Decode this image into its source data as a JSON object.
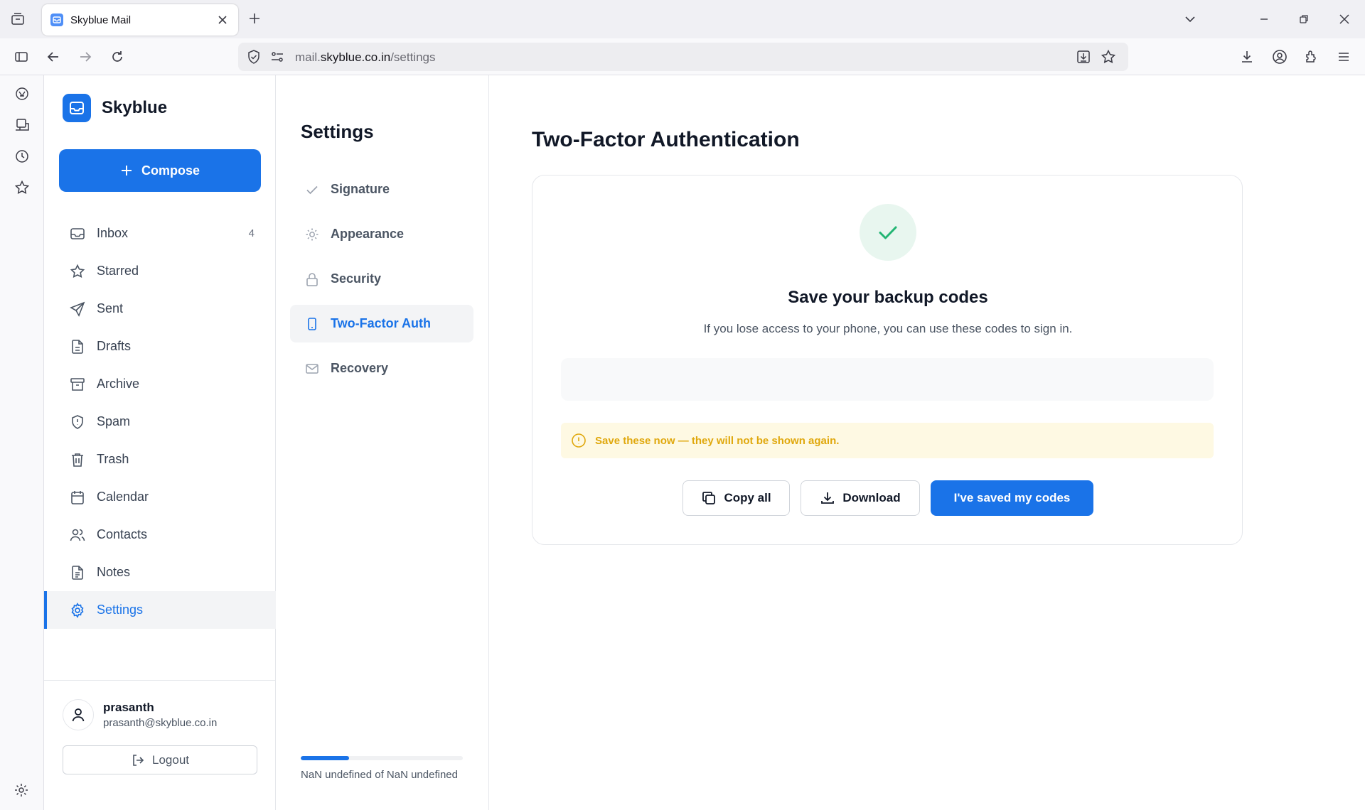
{
  "browser": {
    "tab_title": "Skyblue Mail",
    "url_host": "mail.skyblue.co.in",
    "url_path": "/settings"
  },
  "app": {
    "brand": "Skyblue",
    "compose_label": "Compose",
    "nav": [
      {
        "label": "Inbox",
        "icon": "inbox-icon",
        "count": "4"
      },
      {
        "label": "Starred",
        "icon": "star-icon"
      },
      {
        "label": "Sent",
        "icon": "send-icon"
      },
      {
        "label": "Drafts",
        "icon": "file-icon"
      },
      {
        "label": "Archive",
        "icon": "archive-icon"
      },
      {
        "label": "Spam",
        "icon": "shield-icon"
      },
      {
        "label": "Trash",
        "icon": "trash-icon"
      },
      {
        "label": "Calendar",
        "icon": "calendar-icon"
      },
      {
        "label": "Contacts",
        "icon": "users-icon"
      },
      {
        "label": "Notes",
        "icon": "notes-icon"
      },
      {
        "label": "Settings",
        "icon": "gear-icon",
        "active": true
      }
    ],
    "user": {
      "name": "prasanth",
      "email": "prasanth@skyblue.co.in"
    },
    "logout_label": "Logout"
  },
  "settings": {
    "title": "Settings",
    "items": [
      {
        "label": "Signature",
        "icon": "check-icon"
      },
      {
        "label": "Appearance",
        "icon": "sun-icon"
      },
      {
        "label": "Security",
        "icon": "lock-icon"
      },
      {
        "label": "Two-Factor Auth",
        "icon": "phone-icon",
        "active": true
      },
      {
        "label": "Recovery",
        "icon": "mail-icon"
      }
    ],
    "storage_fraction": 0.3,
    "storage_text": "NaN undefined of NaN undefined"
  },
  "main": {
    "title": "Two-Factor Authentication",
    "heading": "Save your backup codes",
    "subtitle": "If you lose access to your phone, you can use these codes to sign in.",
    "warning": "Save these now — they will not be shown again.",
    "buttons": {
      "copy_all": "Copy all",
      "download": "Download",
      "saved": "I've saved my codes"
    }
  },
  "colors": {
    "accent": "#1a73e8",
    "success": "#22b573",
    "warning": "#e0a80d"
  }
}
